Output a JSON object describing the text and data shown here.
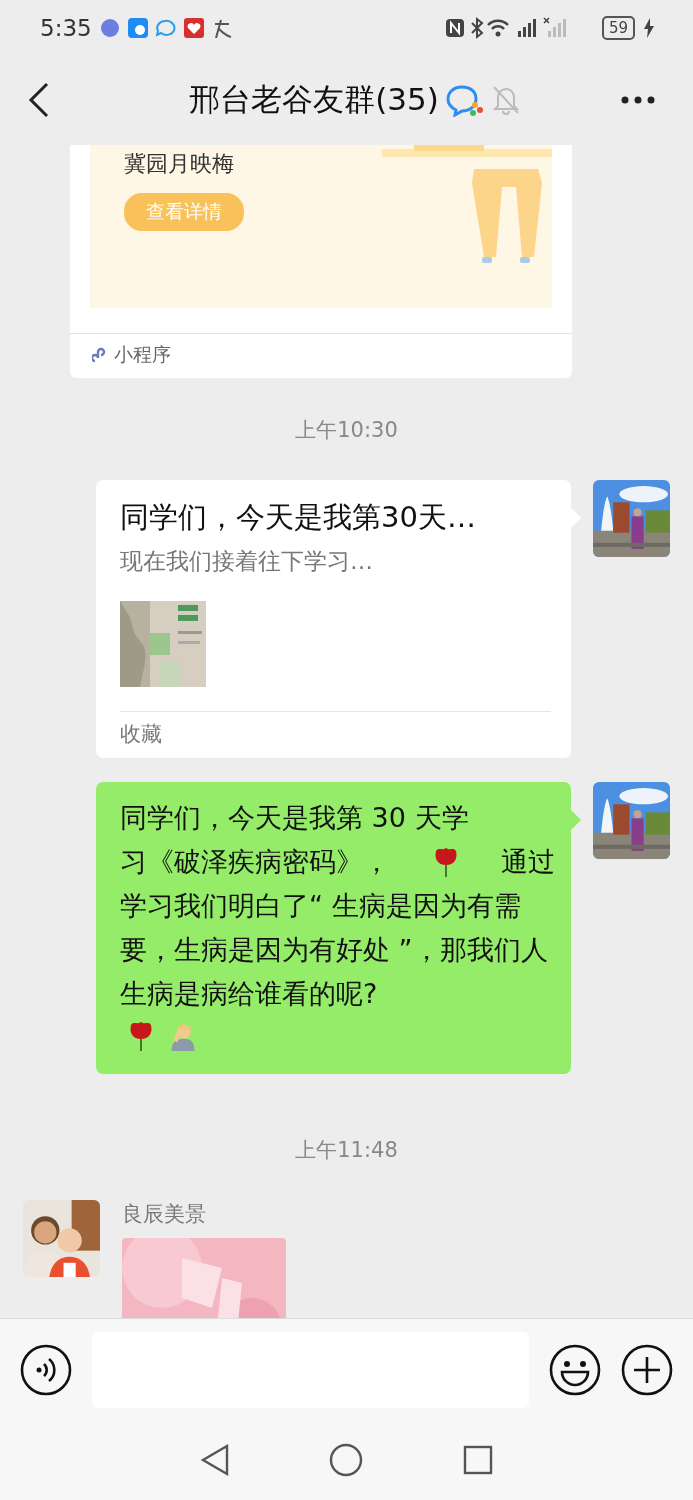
{
  "status_bar": {
    "time": "5:35",
    "battery": "59"
  },
  "header": {
    "title": "邢台老谷友群(35)",
    "muted": true
  },
  "messages": [
    {
      "kind": "mini_program",
      "title": "冀园月映梅",
      "button": "查看详情",
      "source": "小程序"
    },
    {
      "kind": "time",
      "text": "上午10:30"
    },
    {
      "kind": "favorite",
      "outgoing": true,
      "title": "同学们，今天是我第30天…",
      "description": "现在我们接着往下学习…",
      "footer": "收藏"
    },
    {
      "kind": "text",
      "outgoing": true,
      "parts": [
        "同学们，今天是我第 30 天学",
        "习《破泽疾病密码》，",
        "通过",
        "学习我们明白了“ 生病是因为有需要，生病是因为有好处 ”，那我们人生病是病给谁看的呢?"
      ]
    },
    {
      "kind": "time",
      "text": "上午11:48"
    },
    {
      "kind": "sticker",
      "outgoing": false,
      "sender": "良辰美景"
    }
  ]
}
